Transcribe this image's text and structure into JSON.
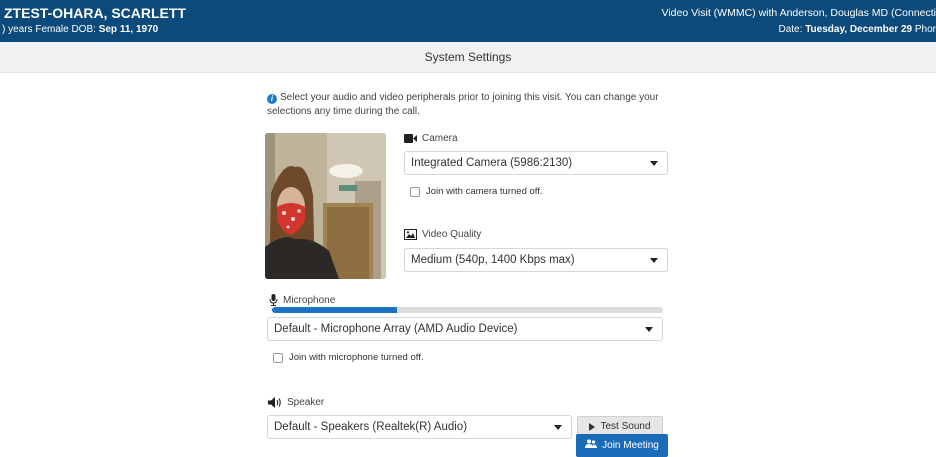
{
  "header": {
    "patient_name": "ZTEST-OHARA, SCARLETT",
    "demographics_prefix": ") years Female DOB:",
    "dob": "Sep 11, 1970",
    "visit_info": "Video Visit (WMMC) with Anderson, Douglas MD (Connecti",
    "date_label": "Date:",
    "date_value": "Tuesday, December 29",
    "date_suffix": "Phor"
  },
  "title": "System Settings",
  "info_text": "Select your audio and video peripherals prior to joining this visit. You can change your selections any time during the call.",
  "camera": {
    "label": "Camera",
    "selected": "Integrated Camera (5986:2130)",
    "checkbox_label": "Join with camera turned off.",
    "checked": false
  },
  "video_quality": {
    "label": "Video Quality",
    "selected": "Medium (540p, 1400 Kbps max)"
  },
  "microphone": {
    "label": "Microphone",
    "level_fraction": 0.32,
    "selected": "Default - Microphone Array (AMD Audio Device)",
    "checkbox_label": "Join with microphone turned off.",
    "checked": false
  },
  "speaker": {
    "label": "Speaker",
    "selected": "Default - Speakers (Realtek(R) Audio)",
    "test_button": "Test Sound"
  },
  "join_button": "Join Meeting",
  "colors": {
    "header_bg": "#0b4a7a",
    "accent": "#1a6cb8",
    "meter_fill": "#1a73c4"
  }
}
